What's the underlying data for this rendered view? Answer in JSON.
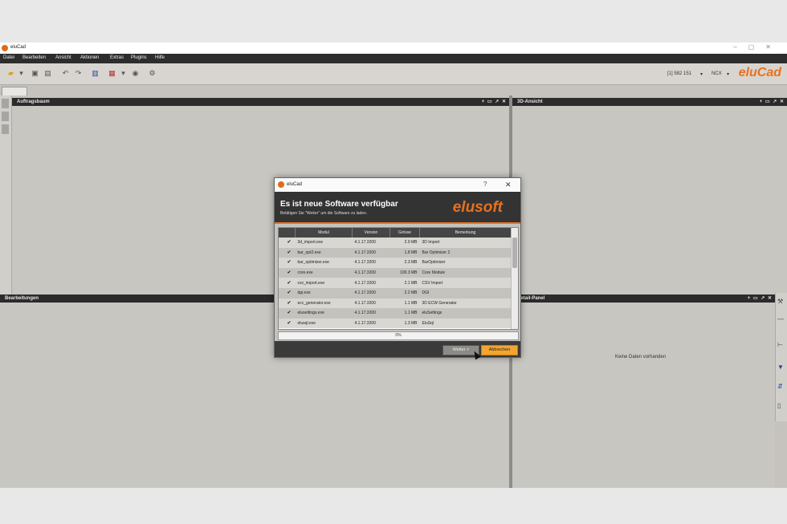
{
  "window": {
    "title": "eluCad",
    "controls": [
      "–",
      "▢",
      "✕"
    ]
  },
  "menu": [
    "Datei",
    "Bearbeiten",
    "Ansicht",
    "Aktionen",
    "Extras",
    "Plugins",
    "Hilfe"
  ],
  "toolbar": {
    "brand": "eluCad",
    "context_value": "[1] 582 151",
    "unit_value": "NCX"
  },
  "panels": {
    "auftragsbaum": "Auftragsbaum",
    "ansicht_3d": "3D-Ansicht",
    "bearbeitungen": "Bearbeitungen",
    "detail": "Detail-Panel",
    "detail_empty": "Keine Daten vorhanden",
    "controls": "+ ▭ ↗ ✕"
  },
  "dialog": {
    "title": "eluCad",
    "help": "?",
    "close": "✕",
    "heading": "Es ist neue Software verfügbar",
    "subheading": "Betätigen Sie \"Weiter\" um die Software zu laden.",
    "brand": "elusoft",
    "columns": [
      "Modul",
      "Version",
      "Grösse",
      "Bemerkung"
    ],
    "rows": [
      {
        "modul": "3d_import.exe",
        "version": "4.1.17.3200",
        "size": "2.9 MB",
        "note": "3D Import"
      },
      {
        "modul": "bar_opt2.exe",
        "version": "4.1.17.3200",
        "size": "1.8 MB",
        "note": "Bar Optimizer 2"
      },
      {
        "modul": "bar_optimizer.exe",
        "version": "4.1.17.3200",
        "size": "2.3 MB",
        "note": "BarOptimizer"
      },
      {
        "modul": "core.exe",
        "version": "4.1.17.3200",
        "size": "100.3 MB",
        "note": "Core Module"
      },
      {
        "modul": "csv_import.exe",
        "version": "4.1.17.3200",
        "size": "2.1 MB",
        "note": "CSV Import"
      },
      {
        "modul": "dgi.exe",
        "version": "4.1.17.3200",
        "size": "2.2 MB",
        "note": "DGI"
      },
      {
        "modul": "ecc_generator.exe",
        "version": "4.1.17.3200",
        "size": "1.1 MB",
        "note": "3D ECW Generator"
      },
      {
        "modul": "elusettings.exe",
        "version": "4.1.17.3200",
        "size": "1.1 MB",
        "note": "eluSettings"
      },
      {
        "modul": "elusql.exe",
        "version": "4.1.17.3200",
        "size": "1.3 MB",
        "note": "EluSql"
      }
    ],
    "progress_label": "0%",
    "progress_value": 0,
    "next_label": "Weiter >",
    "cancel_label": "Abbrechen"
  }
}
